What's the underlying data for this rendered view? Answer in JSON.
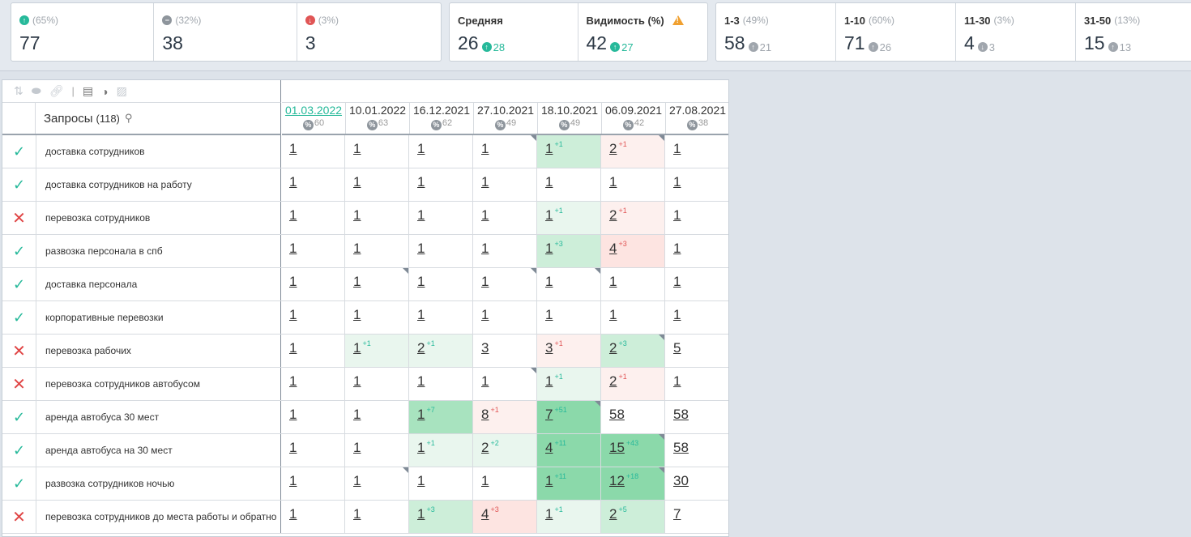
{
  "stats_group1": [
    {
      "pct": "(65%)",
      "value": "77",
      "dir": "up"
    },
    {
      "pct": "(32%)",
      "value": "38",
      "dir": "neutral"
    },
    {
      "pct": "(3%)",
      "value": "3",
      "dir": "down"
    }
  ],
  "stats_group2": [
    {
      "label": "Средняя",
      "value": "26",
      "delta": "28",
      "warn": false
    },
    {
      "label": "Видимость (%)",
      "value": "42",
      "delta": "27",
      "warn": true
    }
  ],
  "stats_group3": [
    {
      "label": "1-3",
      "pct": "(49%)",
      "value": "58",
      "delta": "21",
      "dir": "up"
    },
    {
      "label": "1-10",
      "pct": "(60%)",
      "value": "71",
      "delta": "26",
      "dir": "up"
    },
    {
      "label": "11-30",
      "pct": "(3%)",
      "value": "4",
      "delta": "3",
      "dir": "down"
    },
    {
      "label": "31-50",
      "pct": "(13%)",
      "value": "15",
      "delta": "13",
      "dir": "up"
    }
  ],
  "table": {
    "header_label": "Запросы",
    "header_count": "(118)",
    "dates": [
      {
        "date": "01.03.2022",
        "score": "60",
        "link": true
      },
      {
        "date": "10.01.2022",
        "score": "63",
        "link": false
      },
      {
        "date": "16.12.2021",
        "score": "62",
        "link": false
      },
      {
        "date": "27.10.2021",
        "score": "49",
        "link": false
      },
      {
        "date": "18.10.2021",
        "score": "49",
        "link": false
      },
      {
        "date": "06.09.2021",
        "score": "42",
        "link": false
      },
      {
        "date": "27.08.2021",
        "score": "38",
        "link": false
      }
    ],
    "rows": [
      {
        "ok": true,
        "keyword": "доставка сотрудников",
        "cells": [
          {
            "v": "1"
          },
          {
            "v": "1"
          },
          {
            "v": "1"
          },
          {
            "v": "1",
            "tri": true
          },
          {
            "v": "1",
            "d": "+1",
            "bg": "g2",
            "dc": "g"
          },
          {
            "v": "2",
            "d": "+1",
            "bg": "r1",
            "dc": "r",
            "tri": true
          },
          {
            "v": "1"
          }
        ]
      },
      {
        "ok": true,
        "keyword": "доставка сотрудников на работу",
        "cells": [
          {
            "v": "1"
          },
          {
            "v": "1"
          },
          {
            "v": "1"
          },
          {
            "v": "1"
          },
          {
            "v": "1"
          },
          {
            "v": "1"
          },
          {
            "v": "1"
          }
        ]
      },
      {
        "ok": false,
        "keyword": "перевозка сотрудников",
        "cells": [
          {
            "v": "1"
          },
          {
            "v": "1"
          },
          {
            "v": "1"
          },
          {
            "v": "1"
          },
          {
            "v": "1",
            "d": "+1",
            "bg": "g1",
            "dc": "g"
          },
          {
            "v": "2",
            "d": "+1",
            "bg": "r1",
            "dc": "r"
          },
          {
            "v": "1"
          }
        ]
      },
      {
        "ok": true,
        "keyword": "развозка персонала в спб",
        "cells": [
          {
            "v": "1"
          },
          {
            "v": "1"
          },
          {
            "v": "1"
          },
          {
            "v": "1"
          },
          {
            "v": "1",
            "d": "+3",
            "bg": "g2",
            "dc": "g"
          },
          {
            "v": "4",
            "d": "+3",
            "bg": "r2",
            "dc": "r"
          },
          {
            "v": "1"
          }
        ]
      },
      {
        "ok": true,
        "keyword": "доставка персонала",
        "cells": [
          {
            "v": "1"
          },
          {
            "v": "1",
            "tri": true
          },
          {
            "v": "1"
          },
          {
            "v": "1",
            "tri": true
          },
          {
            "v": "1",
            "tri": true
          },
          {
            "v": "1"
          },
          {
            "v": "1"
          }
        ]
      },
      {
        "ok": true,
        "keyword": "корпоративные перевозки",
        "cells": [
          {
            "v": "1"
          },
          {
            "v": "1"
          },
          {
            "v": "1"
          },
          {
            "v": "1"
          },
          {
            "v": "1"
          },
          {
            "v": "1"
          },
          {
            "v": "1"
          }
        ]
      },
      {
        "ok": false,
        "keyword": "перевозка рабочих",
        "cells": [
          {
            "v": "1"
          },
          {
            "v": "1",
            "d": "+1",
            "bg": "g1",
            "dc": "g"
          },
          {
            "v": "2",
            "d": "+1",
            "bg": "g1",
            "dc": "g"
          },
          {
            "v": "3"
          },
          {
            "v": "3",
            "d": "+1",
            "bg": "r1",
            "dc": "r"
          },
          {
            "v": "2",
            "d": "+3",
            "bg": "g2",
            "dc": "g",
            "tri": true
          },
          {
            "v": "5"
          }
        ]
      },
      {
        "ok": false,
        "keyword": "перевозка сотрудников автобусом",
        "cells": [
          {
            "v": "1"
          },
          {
            "v": "1"
          },
          {
            "v": "1"
          },
          {
            "v": "1",
            "tri": true
          },
          {
            "v": "1",
            "d": "+1",
            "bg": "g1",
            "dc": "g"
          },
          {
            "v": "2",
            "d": "+1",
            "bg": "r1",
            "dc": "r"
          },
          {
            "v": "1"
          }
        ]
      },
      {
        "ok": true,
        "keyword": "аренда автобуса 30 мест",
        "cells": [
          {
            "v": "1"
          },
          {
            "v": "1"
          },
          {
            "v": "1",
            "d": "+7",
            "bg": "g3",
            "dc": "g"
          },
          {
            "v": "8",
            "d": "+1",
            "bg": "r1",
            "dc": "r"
          },
          {
            "v": "7",
            "d": "+51",
            "bg": "g4",
            "dc": "g",
            "tri": true
          },
          {
            "v": "58"
          },
          {
            "v": "58"
          }
        ]
      },
      {
        "ok": true,
        "keyword": "аренда автобуса на 30 мест",
        "cells": [
          {
            "v": "1"
          },
          {
            "v": "1"
          },
          {
            "v": "1",
            "d": "+1",
            "bg": "g1",
            "dc": "g"
          },
          {
            "v": "2",
            "d": "+2",
            "bg": "g1",
            "dc": "g"
          },
          {
            "v": "4",
            "d": "+11",
            "bg": "g4",
            "dc": "g"
          },
          {
            "v": "15",
            "d": "+43",
            "bg": "g4",
            "dc": "g",
            "tri": true
          },
          {
            "v": "58"
          }
        ]
      },
      {
        "ok": true,
        "keyword": "развозка сотрудников ночью",
        "cells": [
          {
            "v": "1"
          },
          {
            "v": "1",
            "tri": true
          },
          {
            "v": "1"
          },
          {
            "v": "1"
          },
          {
            "v": "1",
            "d": "+11",
            "bg": "g4",
            "dc": "g"
          },
          {
            "v": "12",
            "d": "+18",
            "bg": "g4",
            "dc": "g",
            "tri": true
          },
          {
            "v": "30"
          }
        ]
      },
      {
        "ok": false,
        "keyword": "перевозка сотрудников до места работы и обратно",
        "cells": [
          {
            "v": "1"
          },
          {
            "v": "1"
          },
          {
            "v": "1",
            "d": "+3",
            "bg": "g2",
            "dc": "g"
          },
          {
            "v": "4",
            "d": "+3",
            "bg": "r2",
            "dc": "r"
          },
          {
            "v": "1",
            "d": "+1",
            "bg": "g1",
            "dc": "g"
          },
          {
            "v": "2",
            "d": "+5",
            "bg": "g2",
            "dc": "g"
          },
          {
            "v": "7"
          }
        ]
      }
    ]
  }
}
